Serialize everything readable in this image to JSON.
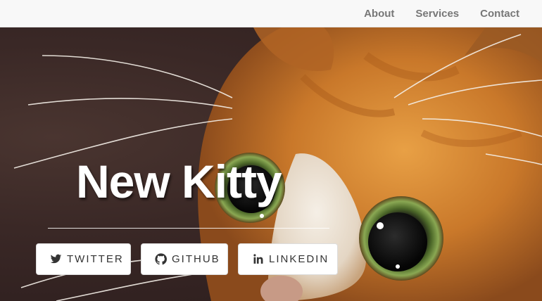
{
  "nav": {
    "links": [
      "About",
      "Services",
      "Contact"
    ]
  },
  "hero": {
    "title": "New Kitty",
    "buttons": [
      {
        "label": "TWITTER",
        "icon": "twitter-icon"
      },
      {
        "label": "GITHUB",
        "icon": "github-icon"
      },
      {
        "label": "LINKEDIN",
        "icon": "linkedin-icon"
      }
    ]
  },
  "colors": {
    "navbar_bg": "#f8f8f8",
    "nav_text": "#777777",
    "button_text": "#333333",
    "fur": "#d8862e"
  }
}
